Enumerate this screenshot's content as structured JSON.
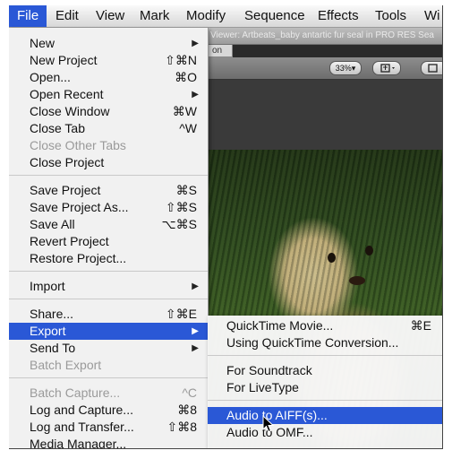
{
  "menubar": {
    "items": [
      "File",
      "Edit",
      "View",
      "Mark",
      "Modify",
      "Sequence",
      "Effects",
      "Tools",
      "Wi"
    ],
    "active": "File"
  },
  "viewer": {
    "title": "Viewer: Artbeats_baby antartic fur seal in PRO RES Sea",
    "subtab": "on",
    "zoom": "33%",
    "zoom_arrow": "▾"
  },
  "file_menu": {
    "items": [
      {
        "label": "New",
        "shortcut": "",
        "submenu": true
      },
      {
        "label": "New Project",
        "shortcut": "⇧⌘N"
      },
      {
        "label": "Open...",
        "shortcut": "⌘O"
      },
      {
        "label": "Open Recent",
        "shortcut": "",
        "submenu": true
      },
      {
        "label": "Close Window",
        "shortcut": "⌘W"
      },
      {
        "label": "Close Tab",
        "shortcut": "^W"
      },
      {
        "label": "Close Other Tabs",
        "shortcut": "",
        "disabled": true
      },
      {
        "label": "Close Project",
        "shortcut": ""
      },
      {
        "label": "Save Project",
        "shortcut": "⌘S"
      },
      {
        "label": "Save Project As...",
        "shortcut": "⇧⌘S"
      },
      {
        "label": "Save All",
        "shortcut": "⌥⌘S"
      },
      {
        "label": "Revert Project",
        "shortcut": ""
      },
      {
        "label": "Restore Project...",
        "shortcut": ""
      },
      {
        "label": "Import",
        "shortcut": "",
        "submenu": true
      },
      {
        "label": "Share...",
        "shortcut": "⇧⌘E"
      },
      {
        "label": "Export",
        "shortcut": "",
        "submenu": true,
        "highlighted": true
      },
      {
        "label": "Send To",
        "shortcut": "",
        "submenu": true
      },
      {
        "label": "Batch Export",
        "shortcut": "",
        "disabled": true
      },
      {
        "label": "Batch Capture...",
        "shortcut": "^C",
        "disabled": true
      },
      {
        "label": "Log and Capture...",
        "shortcut": "⌘8"
      },
      {
        "label": "Log and Transfer...",
        "shortcut": "⇧⌘8"
      },
      {
        "label": "Media Manager...",
        "shortcut": ""
      }
    ],
    "submenu_arrow": "▶"
  },
  "export_submenu": {
    "items": [
      {
        "label": "QuickTime Movie...",
        "shortcut": "⌘E"
      },
      {
        "label": "Using QuickTime Conversion...",
        "shortcut": ""
      },
      {
        "label": "For Soundtrack",
        "shortcut": ""
      },
      {
        "label": "For LiveType",
        "shortcut": ""
      },
      {
        "label": "Audio to AIFF(s)...",
        "shortcut": "",
        "highlighted": true
      },
      {
        "label": "Audio to OMF...",
        "shortcut": ""
      }
    ]
  },
  "colors": {
    "highlight": "#2a58d6",
    "menu_bg": "#f8f8f8",
    "disabled_text": "#9a9a9a"
  }
}
